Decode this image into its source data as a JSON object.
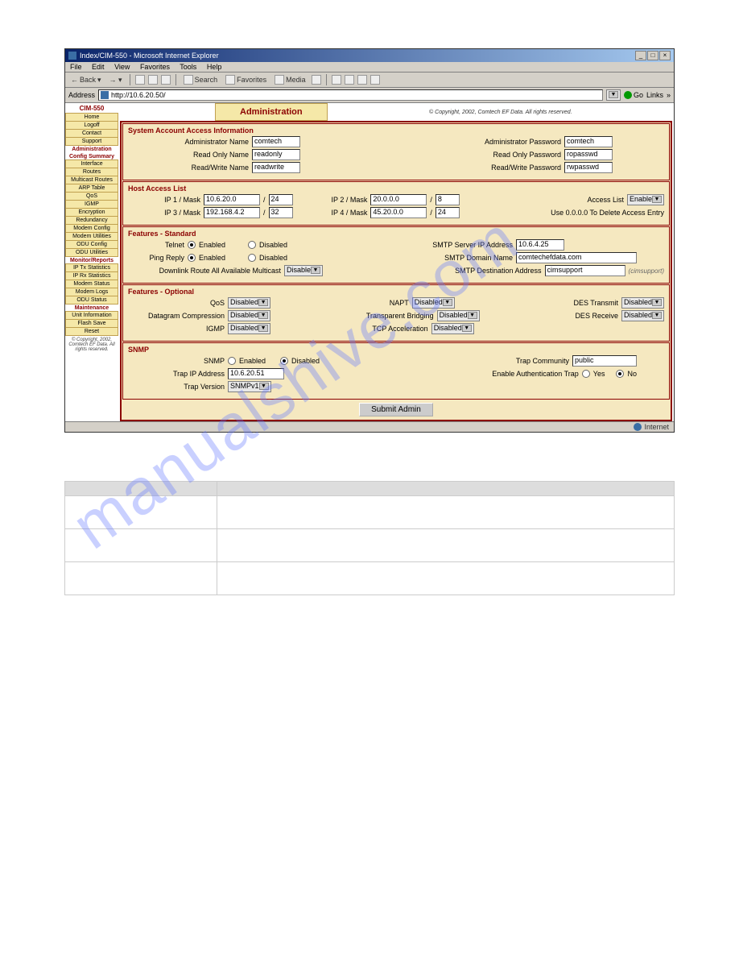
{
  "watermark": "manualshive.com",
  "window": {
    "title": "Index/CIM-550 - Microsoft Internet Explorer"
  },
  "menu": {
    "file": "File",
    "edit": "Edit",
    "view": "View",
    "favorites": "Favorites",
    "tools": "Tools",
    "help": "Help"
  },
  "toolbar": {
    "back": "Back",
    "search": "Search",
    "favorites": "Favorites",
    "media": "Media"
  },
  "addressbar": {
    "label": "Address",
    "value": "http://10.6.20.50/",
    "go": "Go",
    "links": "Links"
  },
  "sidebar": {
    "head": "CIM-550",
    "home_items": [
      "Home",
      "Logoff",
      "Contact",
      "Support"
    ],
    "admin_cat": "Administration",
    "config_cat": "Config Summary",
    "config_items": [
      "Interface",
      "Routes",
      "Multicast Routes",
      "ARP Table",
      "QoS",
      "IGMP",
      "Encryption",
      "Redundancy",
      "Modem Config",
      "Modem Utilities",
      "ODU Config",
      "ODU Utilities"
    ],
    "monitor_cat": "Monitor/Reports",
    "monitor_items": [
      "IP Tx Statistics",
      "IP Rx Statistics",
      "Modem Status",
      "Modem Logs",
      "ODU Status"
    ],
    "maint_cat": "Maintenance",
    "maint_items": [
      "Unit Information",
      "Flash Save",
      "Reset"
    ],
    "copyright": "© Copyright, 2002, Comtech EF Data. All rights reserved."
  },
  "header": {
    "title": "Administration",
    "copyright": "© Copyright, 2002, Comtech EF Data. All rights reserved."
  },
  "account": {
    "title": "System Account Access Information",
    "admin_name_lbl": "Administrator Name",
    "admin_name": "comtech",
    "admin_pass_lbl": "Administrator Password",
    "admin_pass": "comtech",
    "ro_name_lbl": "Read Only Name",
    "ro_name": "readonly",
    "ro_pass_lbl": "Read Only Password",
    "ro_pass": "ropasswd",
    "rw_name_lbl": "Read/Write Name",
    "rw_name": "readwrite",
    "rw_pass_lbl": "Read/Write Password",
    "rw_pass": "rwpasswd"
  },
  "host": {
    "title": "Host Access List",
    "ip1_lbl": "IP 1 / Mask",
    "ip1": "10.6.20.0",
    "m1": "24",
    "ip2_lbl": "IP 2 / Mask",
    "ip2": "20.0.0.0",
    "m2": "8",
    "ip3_lbl": "IP 3 / Mask",
    "ip3": "192.168.4.2",
    "m3": "32",
    "ip4_lbl": "IP 4 / Mask",
    "ip4": "45.20.0.0",
    "m4": "24",
    "access_lbl": "Access List",
    "access_val": "Enable",
    "delete_hint": "Use 0.0.0.0 To Delete Access Entry"
  },
  "features": {
    "title": "Features - Standard",
    "telnet_lbl": "Telnet",
    "enabled": "Enabled",
    "disabled": "Disabled",
    "ping_lbl": "Ping Reply",
    "smtp_server_lbl": "SMTP Server IP Address",
    "smtp_server": "10.6.4.25",
    "smtp_domain_lbl": "SMTP Domain Name",
    "smtp_domain": "comtechefdata.com",
    "smtp_dest_lbl": "SMTP Destination Address",
    "smtp_dest": "cimsupport",
    "smtp_hint": "(cimsupport)",
    "downlink_lbl": "Downlink Route All Available Multicast",
    "downlink_val": "Disable"
  },
  "optional": {
    "title": "Features - Optional",
    "qos_lbl": "QoS",
    "qos": "Disabled",
    "dc_lbl": "Datagram Compression",
    "dc": "Disabled",
    "igmp_lbl": "IGMP",
    "igmp": "Disabled",
    "napt_lbl": "NAPT",
    "napt": "Disabled",
    "tb_lbl": "Transparent Bridging",
    "tb": "Disabled",
    "tcp_lbl": "TCP Acceleration",
    "tcp": "Disabled",
    "des_tx_lbl": "DES Transmit",
    "des_tx": "Disabled",
    "des_rx_lbl": "DES Receive",
    "des_rx": "Disabled"
  },
  "snmp": {
    "title": "SNMP",
    "snmp_lbl": "SNMP",
    "enabled": "Enabled",
    "disabled": "Disabled",
    "trap_ip_lbl": "Trap IP Address",
    "trap_ip": "10.6.20.51",
    "trap_ver_lbl": "Trap Version",
    "trap_ver": "SNMPv1",
    "trap_comm_lbl": "Trap Community",
    "trap_comm": "public",
    "auth_lbl": "Enable Authentication Trap",
    "yes": "Yes",
    "no": "No"
  },
  "submit": "Submit Admin",
  "statusbar": {
    "zone": "Internet"
  }
}
